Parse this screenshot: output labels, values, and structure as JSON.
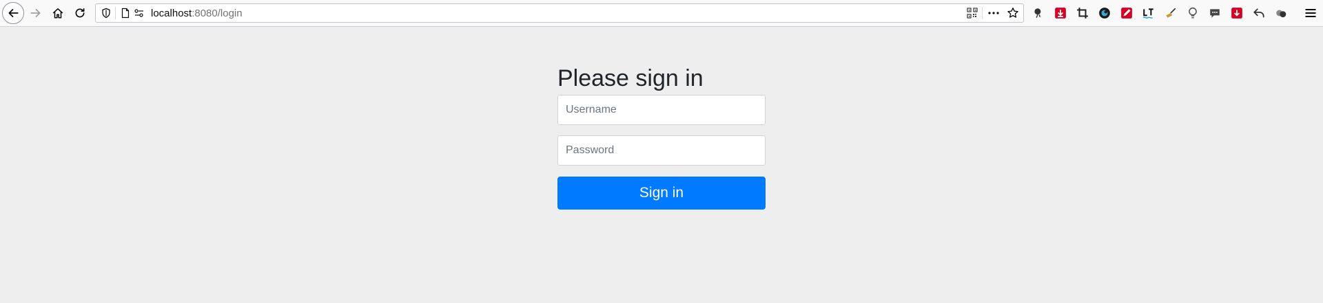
{
  "browser": {
    "url_host": "localhost",
    "url_rest": ":8080/login",
    "extensions": [
      {
        "name": "weather-ext-icon",
        "color": "#333333"
      },
      {
        "name": "download-ext-icon",
        "color": "#d70022"
      },
      {
        "name": "crop-ext-icon",
        "color": "#222222"
      },
      {
        "name": "dark-mode-ext-icon",
        "color": "#1a1a1a"
      },
      {
        "name": "pen-ext-icon",
        "color": "#d70022"
      },
      {
        "name": "languagetool-ext-icon",
        "color": "#111111"
      },
      {
        "name": "broom-ext-icon",
        "color": "#8a6d3b"
      },
      {
        "name": "bulb-ext-icon",
        "color": "#555555"
      },
      {
        "name": "chat-ext-icon",
        "color": "#444444"
      },
      {
        "name": "pocket-ext-icon",
        "color": "#d70022"
      },
      {
        "name": "undo-ext-icon",
        "color": "#333333"
      },
      {
        "name": "users-ext-icon",
        "color": "#333333"
      }
    ]
  },
  "login": {
    "heading": "Please sign in",
    "username_placeholder": "Username",
    "password_placeholder": "Password",
    "submit_label": "Sign in",
    "accent_color": "#007bff"
  }
}
